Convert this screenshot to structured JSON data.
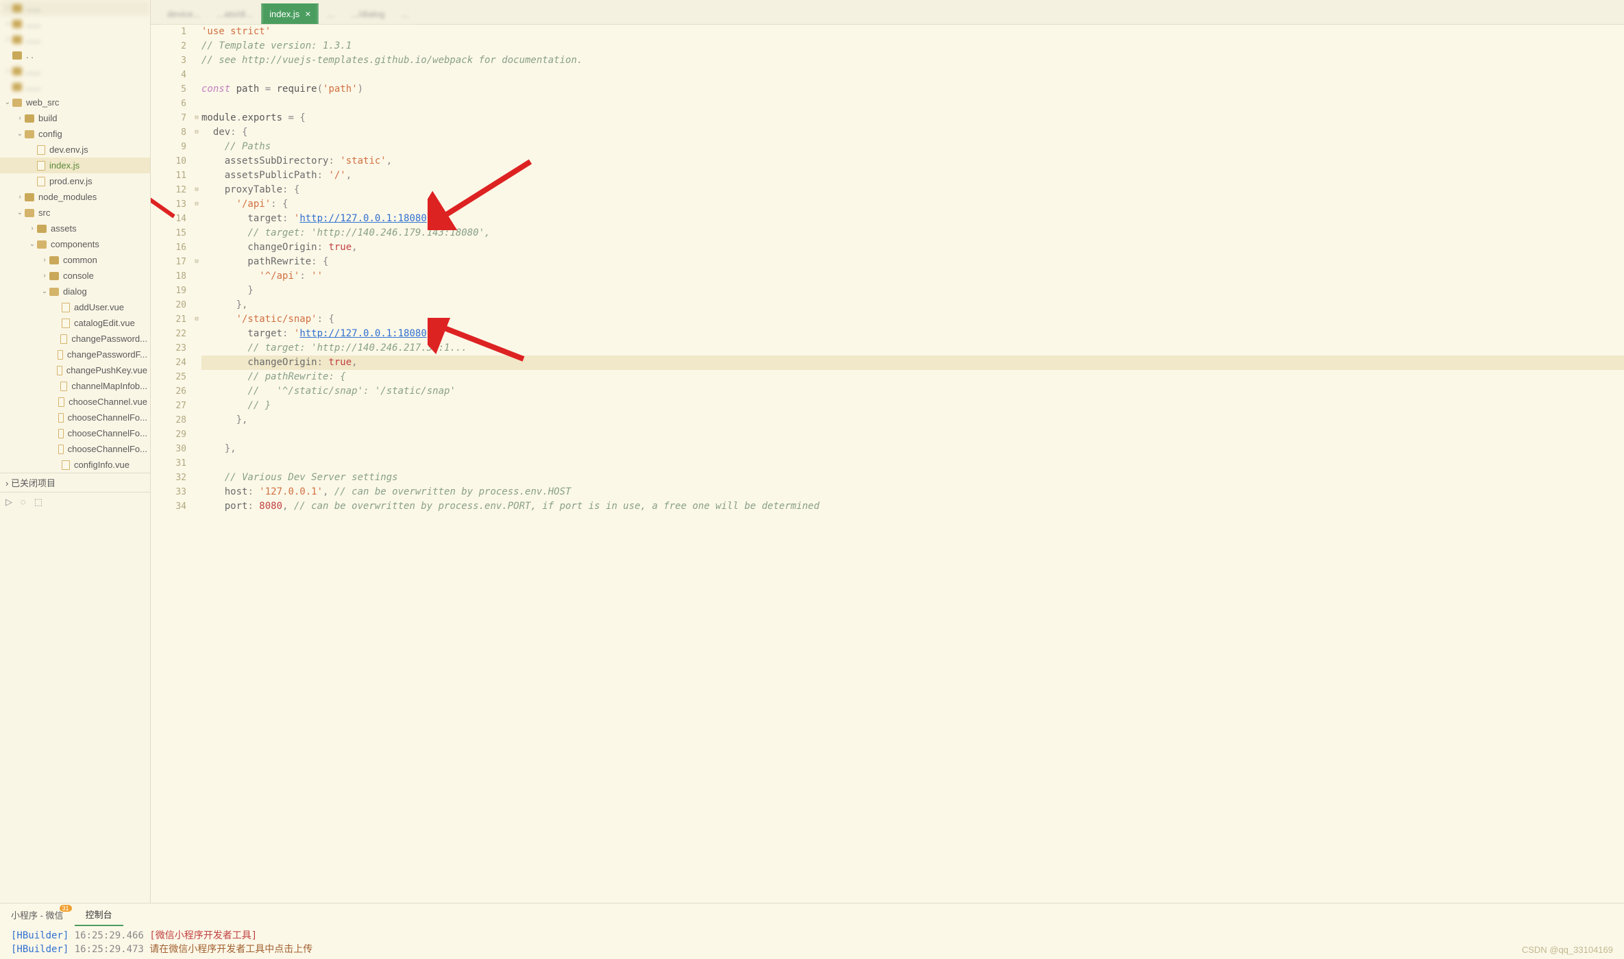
{
  "sidebar": {
    "tree": [
      {
        "indent": 0,
        "chev": "›",
        "icon": "folder",
        "label": "",
        "blur": true
      },
      {
        "indent": 0,
        "chev": "›",
        "icon": "folder",
        "label": "",
        "blur": true
      },
      {
        "indent": 0,
        "chev": "›",
        "icon": "folder",
        "label": "",
        "blur": true
      },
      {
        "indent": 0,
        "chev": "",
        "icon": "folder",
        "label": ". .",
        "blur": false
      },
      {
        "indent": 0,
        "chev": "›",
        "icon": "folder",
        "label": "",
        "blur": true
      },
      {
        "indent": 0,
        "chev": "",
        "icon": "folder",
        "label": "",
        "blur": true
      },
      {
        "indent": 0,
        "chev": "⌄",
        "icon": "folder-open",
        "label": "web_src",
        "blur": false
      },
      {
        "indent": 1,
        "chev": "›",
        "icon": "folder",
        "label": "build",
        "blur": false
      },
      {
        "indent": 1,
        "chev": "⌄",
        "icon": "folder-open",
        "label": "config",
        "blur": false
      },
      {
        "indent": 2,
        "chev": "",
        "icon": "file",
        "label": "dev.env.js",
        "blur": false
      },
      {
        "indent": 2,
        "chev": "",
        "icon": "file",
        "label": "index.js",
        "blur": false,
        "selected": true,
        "green": true
      },
      {
        "indent": 2,
        "chev": "",
        "icon": "file",
        "label": "prod.env.js",
        "blur": false
      },
      {
        "indent": 1,
        "chev": "›",
        "icon": "folder",
        "label": "node_modules",
        "blur": false
      },
      {
        "indent": 1,
        "chev": "⌄",
        "icon": "folder-open",
        "label": "src",
        "blur": false
      },
      {
        "indent": 2,
        "chev": "›",
        "icon": "folder",
        "label": "assets",
        "blur": false
      },
      {
        "indent": 2,
        "chev": "⌄",
        "icon": "folder-open",
        "label": "components",
        "blur": false
      },
      {
        "indent": 3,
        "chev": "›",
        "icon": "folder",
        "label": "common",
        "blur": false
      },
      {
        "indent": 3,
        "chev": "›",
        "icon": "folder",
        "label": "console",
        "blur": false
      },
      {
        "indent": 3,
        "chev": "⌄",
        "icon": "folder-open",
        "label": "dialog",
        "blur": false
      },
      {
        "indent": 4,
        "chev": "",
        "icon": "file",
        "label": "addUser.vue",
        "blur": false
      },
      {
        "indent": 4,
        "chev": "",
        "icon": "file",
        "label": "catalogEdit.vue",
        "blur": false
      },
      {
        "indent": 4,
        "chev": "",
        "icon": "file",
        "label": "changePassword...",
        "blur": false
      },
      {
        "indent": 4,
        "chev": "",
        "icon": "file",
        "label": "changePasswordF...",
        "blur": false
      },
      {
        "indent": 4,
        "chev": "",
        "icon": "file",
        "label": "changePushKey.vue",
        "blur": false
      },
      {
        "indent": 4,
        "chev": "",
        "icon": "file",
        "label": "channelMapInfob...",
        "blur": false
      },
      {
        "indent": 4,
        "chev": "",
        "icon": "file",
        "label": "chooseChannel.vue",
        "blur": false
      },
      {
        "indent": 4,
        "chev": "",
        "icon": "file",
        "label": "chooseChannelFo...",
        "blur": false
      },
      {
        "indent": 4,
        "chev": "",
        "icon": "file",
        "label": "chooseChannelFo...",
        "blur": false
      },
      {
        "indent": 4,
        "chev": "",
        "icon": "file",
        "label": "chooseChannelFo...",
        "blur": false
      },
      {
        "indent": 4,
        "chev": "",
        "icon": "file",
        "label": "configInfo.vue",
        "blur": false
      }
    ],
    "closed_label": "已关闭项目",
    "footer_icons": [
      "run",
      "ring",
      "cube"
    ]
  },
  "tabs": [
    {
      "label": "device...",
      "dim": true
    },
    {
      "label": "...ats/di...",
      "dim": true
    },
    {
      "label": "index.js",
      "active": true
    },
    {
      "label": "...",
      "dim": true
    },
    {
      "label": ".../dialog",
      "dim": true
    },
    {
      "label": "...",
      "dim": true
    }
  ],
  "code": {
    "first_line": 1,
    "current_line": 24,
    "lines": [
      [
        {
          "t": "'use strict'",
          "c": "str"
        }
      ],
      [
        {
          "t": "// Template version: 1.3.1",
          "c": "comment"
        }
      ],
      [
        {
          "t": "// see http://vuejs-templates.github.io/webpack for documentation.",
          "c": "comment"
        }
      ],
      [],
      [
        {
          "t": "const",
          "c": "kw"
        },
        {
          "t": " path ",
          "c": "ident"
        },
        {
          "t": "=",
          "c": "punc"
        },
        {
          "t": " ",
          "c": ""
        },
        {
          "t": "require",
          "c": "ident"
        },
        {
          "t": "(",
          "c": "punc"
        },
        {
          "t": "'path'",
          "c": "str"
        },
        {
          "t": ")",
          "c": "punc"
        }
      ],
      [],
      [
        {
          "t": "module",
          "c": "ident"
        },
        {
          "t": ".",
          "c": "punc"
        },
        {
          "t": "exports",
          "c": "ident"
        },
        {
          "t": " = {",
          "c": "punc"
        }
      ],
      [
        {
          "t": "  dev",
          "c": "prop"
        },
        {
          "t": ": {",
          "c": "punc"
        }
      ],
      [
        {
          "t": "    ",
          "c": ""
        },
        {
          "t": "// Paths",
          "c": "comment"
        }
      ],
      [
        {
          "t": "    assetsSubDirectory",
          "c": "prop"
        },
        {
          "t": ": ",
          "c": "punc"
        },
        {
          "t": "'static'",
          "c": "str"
        },
        {
          "t": ",",
          "c": "punc"
        }
      ],
      [
        {
          "t": "    assetsPublicPath",
          "c": "prop"
        },
        {
          "t": ": ",
          "c": "punc"
        },
        {
          "t": "'/'",
          "c": "str"
        },
        {
          "t": ",",
          "c": "punc"
        }
      ],
      [
        {
          "t": "    proxyTable",
          "c": "prop"
        },
        {
          "t": ": {",
          "c": "punc"
        }
      ],
      [
        {
          "t": "      ",
          "c": ""
        },
        {
          "t": "'/api'",
          "c": "str"
        },
        {
          "t": ": {",
          "c": "punc"
        }
      ],
      [
        {
          "t": "        target",
          "c": "prop"
        },
        {
          "t": ": ",
          "c": "punc"
        },
        {
          "t": "'",
          "c": "str"
        },
        {
          "t": "http://127.0.0.1:18080",
          "c": "str-http"
        },
        {
          "t": "'",
          "c": "str"
        },
        {
          "t": ",",
          "c": "punc"
        }
      ],
      [
        {
          "t": "        ",
          "c": ""
        },
        {
          "t": "// target: 'http://140.246.179.143:18080',",
          "c": "comment"
        }
      ],
      [
        {
          "t": "        changeOrigin",
          "c": "prop"
        },
        {
          "t": ": ",
          "c": "punc"
        },
        {
          "t": "true",
          "c": "bool"
        },
        {
          "t": ",",
          "c": "punc"
        }
      ],
      [
        {
          "t": "        pathRewrite",
          "c": "prop"
        },
        {
          "t": ": {",
          "c": "punc"
        }
      ],
      [
        {
          "t": "          ",
          "c": ""
        },
        {
          "t": "'^/api'",
          "c": "str"
        },
        {
          "t": ": ",
          "c": "punc"
        },
        {
          "t": "''",
          "c": "str"
        }
      ],
      [
        {
          "t": "        }",
          "c": "punc"
        }
      ],
      [
        {
          "t": "      },",
          "c": "punc"
        }
      ],
      [
        {
          "t": "      ",
          "c": ""
        },
        {
          "t": "'/static/snap'",
          "c": "str"
        },
        {
          "t": ": {",
          "c": "punc"
        }
      ],
      [
        {
          "t": "        target",
          "c": "prop"
        },
        {
          "t": ": ",
          "c": "punc"
        },
        {
          "t": "'",
          "c": "str"
        },
        {
          "t": "http://127.0.0.1:18080",
          "c": "str-http"
        },
        {
          "t": "'",
          "c": "str"
        },
        {
          "t": ",",
          "c": "punc"
        }
      ],
      [
        {
          "t": "        ",
          "c": ""
        },
        {
          "t": "// target: 'http://140.246.217.36:1...",
          "c": "comment"
        }
      ],
      [
        {
          "t": "        changeOrigin",
          "c": "prop"
        },
        {
          "t": ": ",
          "c": "punc"
        },
        {
          "t": "true",
          "c": "bool"
        },
        {
          "t": ",",
          "c": "punc"
        }
      ],
      [
        {
          "t": "        ",
          "c": ""
        },
        {
          "t": "// pathRewrite: {",
          "c": "comment"
        }
      ],
      [
        {
          "t": "        ",
          "c": ""
        },
        {
          "t": "//   '^/static/snap': '/static/snap'",
          "c": "comment"
        }
      ],
      [
        {
          "t": "        ",
          "c": ""
        },
        {
          "t": "// }",
          "c": "comment"
        }
      ],
      [
        {
          "t": "      },",
          "c": "punc"
        }
      ],
      [],
      [
        {
          "t": "    },",
          "c": "punc"
        }
      ],
      [],
      [
        {
          "t": "    ",
          "c": ""
        },
        {
          "t": "// Various Dev Server settings",
          "c": "comment"
        }
      ],
      [
        {
          "t": "    host",
          "c": "prop"
        },
        {
          "t": ": ",
          "c": "punc"
        },
        {
          "t": "'127.0.0.1'",
          "c": "str"
        },
        {
          "t": ", ",
          "c": "punc"
        },
        {
          "t": "// can be overwritten by process.env.HOST",
          "c": "comment"
        }
      ],
      [
        {
          "t": "    port",
          "c": "prop"
        },
        {
          "t": ": ",
          "c": "punc"
        },
        {
          "t": "8080",
          "c": "num"
        },
        {
          "t": ", ",
          "c": "punc"
        },
        {
          "t": "// can be overwritten by process.env.PORT, if port is in use, a free one will be determined",
          "c": "comment"
        }
      ]
    ],
    "fold": [
      null,
      null,
      null,
      null,
      null,
      null,
      "⊟",
      "⊟",
      null,
      null,
      null,
      "⊟",
      "⊟",
      null,
      null,
      null,
      "⊟",
      null,
      null,
      null,
      "⊟",
      null,
      null,
      null,
      null,
      null,
      null,
      null,
      null,
      null,
      null,
      null,
      null,
      null
    ]
  },
  "console": {
    "tabs": [
      {
        "label": "小程序 - 微信",
        "badge": "31"
      },
      {
        "label": "控制台",
        "active": true
      }
    ],
    "lines": [
      {
        "tag": "[HBuilder]",
        "time": "16:25:29.466",
        "msg": "[微信小程序开发者工具]",
        "msgClass": "c-red"
      },
      {
        "tag": "[HBuilder]",
        "time": "16:25:29.473",
        "msg": "请在微信小程序开发者工具中点击上传",
        "msgClass": "c-brown"
      }
    ]
  },
  "watermark": "CSDN @qq_33104169"
}
